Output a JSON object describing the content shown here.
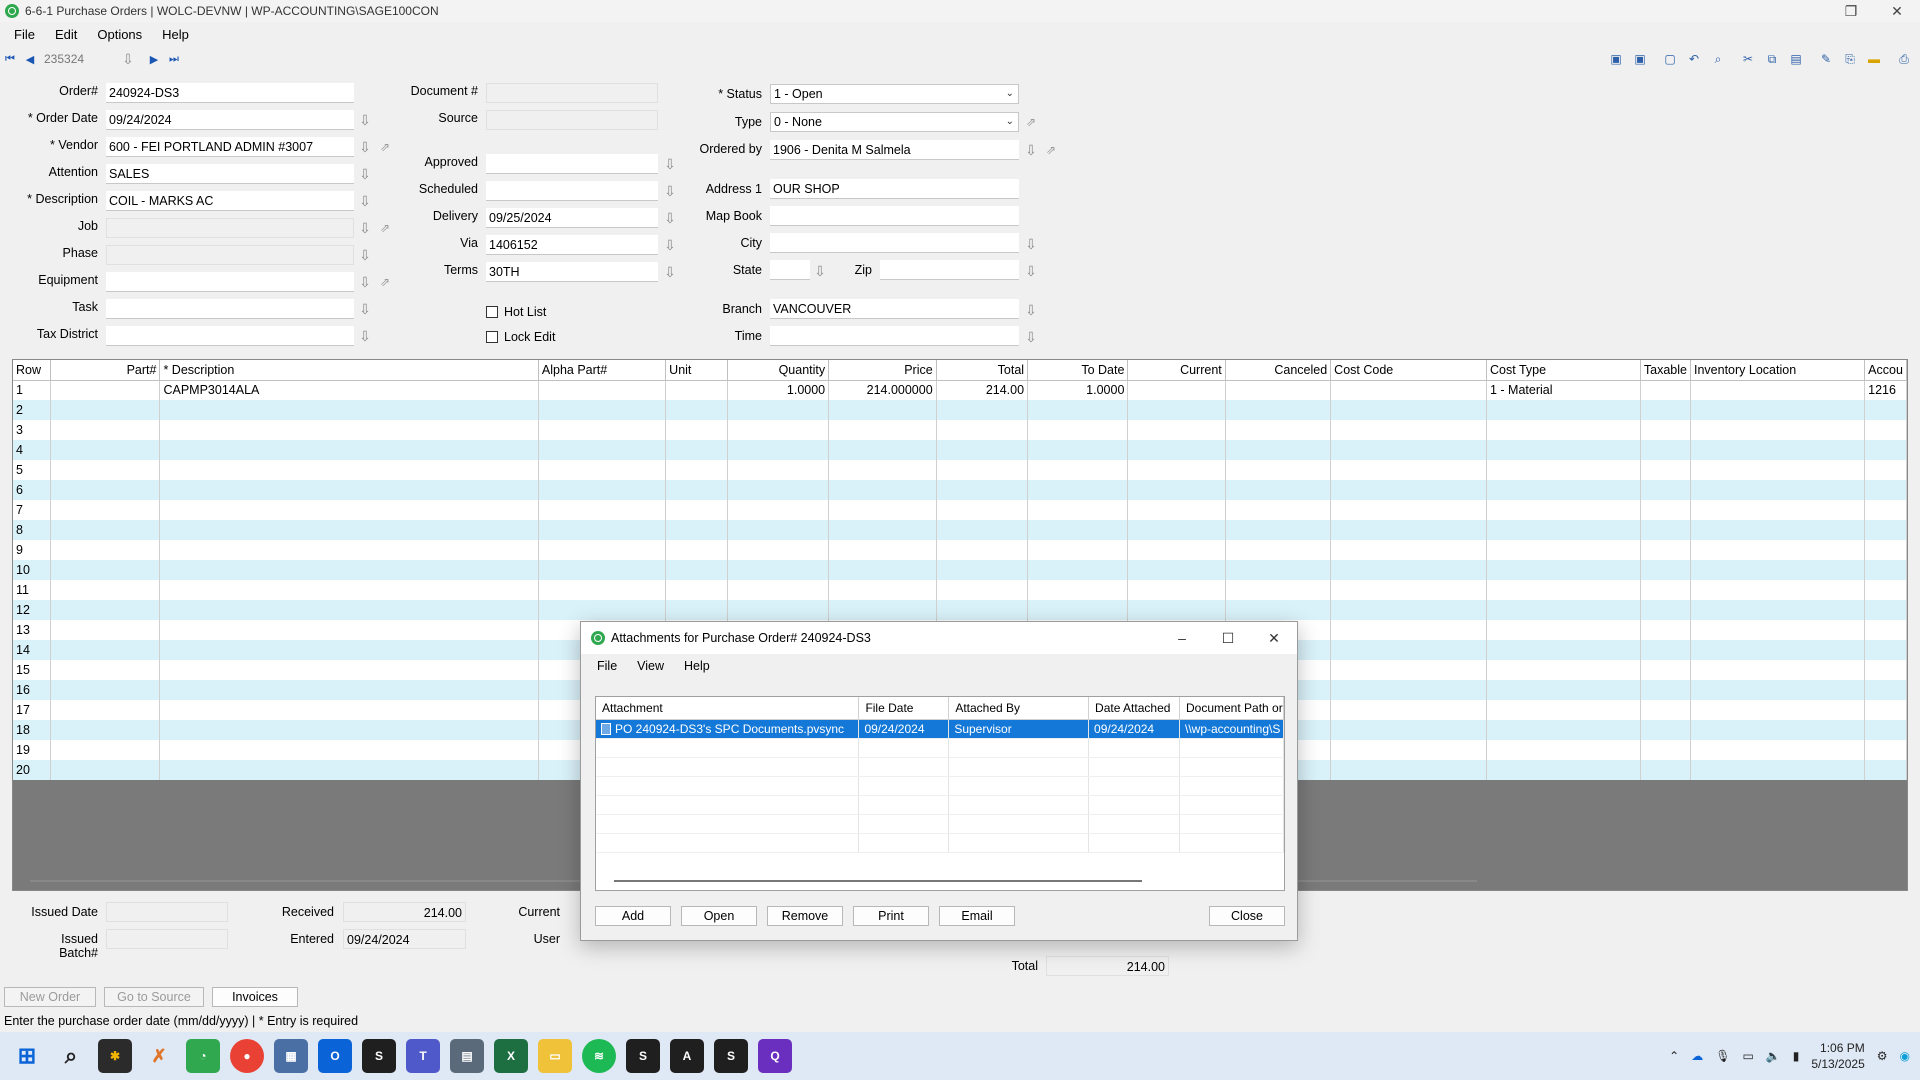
{
  "window": {
    "title": "6-6-1 Purchase Orders  |  WOLC-DEVNW  |  WP-ACCOUNTING\\SAGE100CON"
  },
  "menu": [
    "File",
    "Edit",
    "Options",
    "Help"
  ],
  "nav": {
    "record": "235324"
  },
  "form": {
    "order_label": "Order#",
    "order_value": "240924-DS3",
    "order_date_label": "* Order Date",
    "order_date_value": "09/24/2024",
    "vendor_label": "* Vendor",
    "vendor_value": "600 - FEI PORTLAND ADMIN #3007",
    "attention_label": "Attention",
    "attention_value": "SALES",
    "description_label": "* Description",
    "description_value": "COIL - MARKS AC",
    "job_label": "Job",
    "phase_label": "Phase",
    "equipment_label": "Equipment",
    "task_label": "Task",
    "tax_district_label": "Tax District",
    "document_label": "Document #",
    "source_label": "Source",
    "approved_label": "Approved",
    "scheduled_label": "Scheduled",
    "delivery_label": "Delivery",
    "delivery_value": "09/25/2024",
    "via_label": "Via",
    "via_value": "1406152",
    "terms_label": "Terms",
    "terms_value": "30TH",
    "hot_list_label": "Hot List",
    "lock_edit_label": "Lock Edit",
    "status_label": "* Status",
    "status_value": "1 - Open",
    "type_label": "Type",
    "type_value": "0 - None",
    "ordered_by_label": "Ordered by",
    "ordered_by_value": "1906 - Denita M Salmela",
    "address1_label": "Address 1",
    "address1_value": "OUR SHOP",
    "map_book_label": "Map Book",
    "city_label": "City",
    "state_label": "State",
    "zip_label": "Zip",
    "branch_label": "Branch",
    "branch_value": "VANCOUVER",
    "time_label": "Time"
  },
  "grid": {
    "headers": [
      "Row",
      "Part#",
      "* Description",
      "Alpha Part#",
      "Unit",
      "Quantity",
      "Price",
      "Total",
      "To Date",
      "Current",
      "Canceled",
      "Cost Code",
      "Cost Type",
      "Taxable",
      "Inventory Location",
      "Accou"
    ],
    "row1": {
      "row": "1",
      "description": "CAPMP3014ALA",
      "quantity": "1.0000",
      "price": "214.000000",
      "total": "214.00",
      "to_date": "1.0000",
      "cost_type": "1 - Material",
      "account": "1216"
    },
    "row_numbers": [
      "2",
      "3",
      "4",
      "5",
      "6",
      "7",
      "8",
      "9",
      "10",
      "11",
      "12",
      "13",
      "14",
      "15",
      "16",
      "17",
      "18",
      "19",
      "20"
    ]
  },
  "footer": {
    "issued_date_label": "Issued Date",
    "issued_batch_label": "Issued Batch#",
    "received_label": "Received",
    "received_value": "214.00",
    "entered_label": "Entered",
    "entered_value": "09/24/2024",
    "current_label": "Current",
    "user_label": "User",
    "total_label": "Total",
    "total_value": "214.00",
    "new_order": "New Order",
    "go_to_source": "Go to Source",
    "invoices": "Invoices",
    "status_text": "Enter the purchase order date (mm/dd/yyyy)  |  * Entry is required"
  },
  "dialog": {
    "title": "Attachments for Purchase Order# 240924-DS3",
    "menu": [
      "File",
      "View",
      "Help"
    ],
    "columns": [
      "Attachment",
      "File Date",
      "Attached By",
      "Date Attached",
      "Document Path or"
    ],
    "rows": [
      {
        "attachment": "PO 240924-DS3's SPC Documents.pvsync",
        "file_date": "09/24/2024",
        "attached_by": "Supervisor",
        "date_attached": "09/24/2024",
        "path": "\\\\wp-accounting\\S"
      }
    ],
    "buttons": {
      "add": "Add",
      "open": "Open",
      "remove": "Remove",
      "print": "Print",
      "email": "Email",
      "close": "Close"
    }
  },
  "taskbar": {
    "time": "1:06 PM",
    "date": "5/13/2025"
  },
  "colors": {
    "accent": "#1378d7",
    "row_alt": "#d9f1f8",
    "app_green": "#2fa84f"
  }
}
